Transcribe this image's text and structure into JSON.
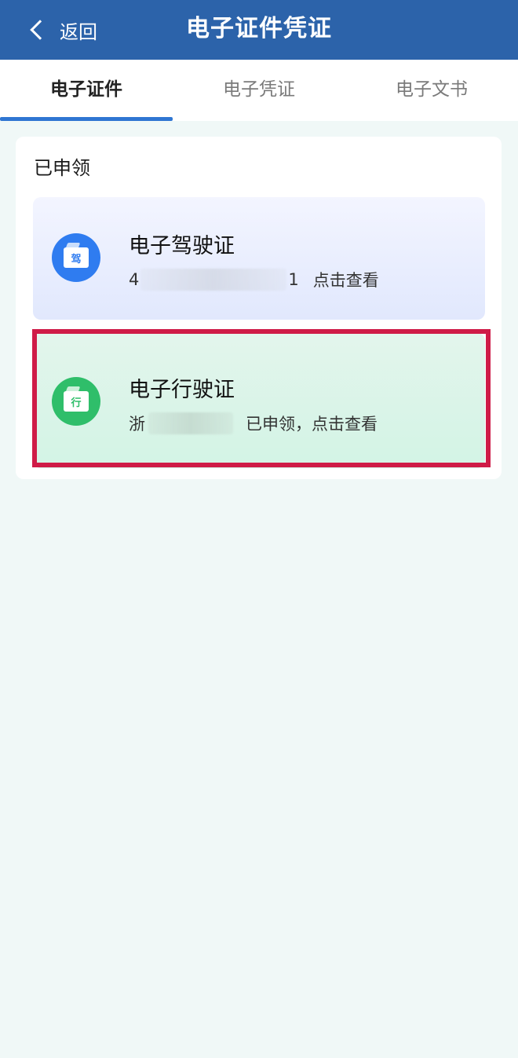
{
  "header": {
    "back_label": "返回",
    "title": "电子证件凭证"
  },
  "tabs": [
    {
      "label": "电子证件",
      "active": true
    },
    {
      "label": "电子凭证",
      "active": false
    },
    {
      "label": "电子文书",
      "active": false
    }
  ],
  "section": {
    "title": "已申领"
  },
  "cards": [
    {
      "name": "电子驾驶证",
      "badge_char": "驾",
      "icon": "driver-license-icon",
      "id_prefix": "4",
      "id_suffix": "1",
      "action": "点击查看",
      "color": "#2f7cf0"
    },
    {
      "name": "电子行驶证",
      "badge_char": "行",
      "icon": "vehicle-license-icon",
      "id_prefix": "浙",
      "status": "已申领，点击查看",
      "color": "#2fbe6a"
    }
  ],
  "colors": {
    "header_bg": "#2c63aa",
    "tab_indicator": "#2f76d2",
    "highlight_border": "#cf1b47",
    "page_bg": "#f0f8f7"
  }
}
